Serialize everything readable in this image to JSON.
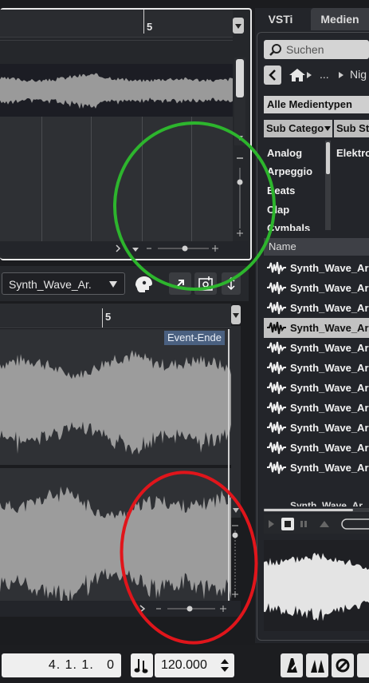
{
  "top_editor": {
    "ruler_marker": "5"
  },
  "lower_editor": {
    "file_selector_value": "Synth_Wave_Ar.",
    "ruler_marker": "5",
    "event_end_label": "Event-Ende"
  },
  "media_panel": {
    "tabs": [
      "VSTi",
      "Medien"
    ],
    "search_placeholder": "Suchen",
    "breadcrumb_ellipsis": "...",
    "breadcrumb_item": "Nig",
    "media_type_select": "Alle Medientypen",
    "filter_headers": [
      "Sub Catego",
      "Sub St"
    ],
    "categories": [
      "Analog",
      "Arpeggio",
      "Beats",
      "Clap",
      "Cymbals"
    ],
    "right_column_value": "Elektro",
    "name_column_header": "Name",
    "result_items": [
      "Synth_Wave_Ar",
      "Synth_Wave_Ar",
      "Synth_Wave_Ar",
      "Synth_Wave_Ar",
      "Synth_Wave_Ar",
      "Synth_Wave_Ar",
      "Synth_Wave_Ar",
      "Synth_Wave_Ar",
      "Synth_Wave_Ar",
      "Synth_Wave_Ar",
      "Synth_Wave_Ar",
      "Synth_Wave_Ar"
    ],
    "selected_item_index": 3
  },
  "transport": {
    "position": "4. 1. 1.   0",
    "tempo": "120.000"
  },
  "colors": {
    "background": "#1b1c1f",
    "event_end_tag": "#4a6080",
    "annotation_green": "#2db52d",
    "annotation_red": "#e0151b",
    "selected_row": "#c2c2c2"
  },
  "icons": {
    "search": "search-icon",
    "back": "chevron-left-icon",
    "home": "home-icon",
    "next": "chevron-right-icon",
    "waveform": "waveform-icon",
    "tempo": "tempo-note-icon"
  }
}
